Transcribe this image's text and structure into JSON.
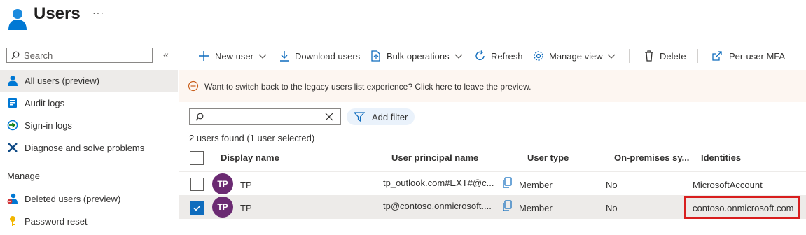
{
  "header": {
    "title": "Users",
    "more_label": "···"
  },
  "sidebar": {
    "search_placeholder": "Search",
    "collapse_label": "«",
    "items": [
      {
        "label": "All users (preview)",
        "icon": "user-icon",
        "active": true
      },
      {
        "label": "Audit logs",
        "icon": "audit-log-icon"
      },
      {
        "label": "Sign-in logs",
        "icon": "sign-in-icon"
      },
      {
        "label": "Diagnose and solve problems",
        "icon": "wrench-icon"
      }
    ],
    "manage_heading": "Manage",
    "manage_items": [
      {
        "label": "Deleted users (preview)",
        "icon": "deleted-user-icon"
      },
      {
        "label": "Password reset",
        "icon": "key-icon"
      }
    ]
  },
  "toolbar": {
    "new_user": "New user",
    "download_users": "Download users",
    "bulk_operations": "Bulk operations",
    "refresh": "Refresh",
    "manage_view": "Manage view",
    "delete": "Delete",
    "per_user_mfa": "Per-user MFA"
  },
  "banner": {
    "message": "Want to switch back to the legacy users list experience? Click here to leave the preview."
  },
  "filter": {
    "search_value": "",
    "add_filter": "Add filter"
  },
  "results": {
    "count_text": "2 users found (1 user selected)"
  },
  "table": {
    "columns": [
      "Display name",
      "User principal name",
      "User type",
      "On-premises sy...",
      "Identities"
    ],
    "rows": [
      {
        "selected": false,
        "initials": "TP",
        "display_name": "TP",
        "upn": "tp_outlook.com#EXT#@c...",
        "user_type": "Member",
        "on_prem": "No",
        "identities": "MicrosoftAccount"
      },
      {
        "selected": true,
        "initials": "TP",
        "display_name": "TP",
        "upn": "tp@contoso.onmicrosoft....",
        "user_type": "Member",
        "on_prem": "No",
        "identities": "contoso.onmicrosoft.com"
      }
    ]
  },
  "colors": {
    "accent": "#0f6cbd",
    "avatar": "#6b2a72",
    "highlight": "#d81e1e",
    "banner_bg": "#fdf6f1"
  }
}
